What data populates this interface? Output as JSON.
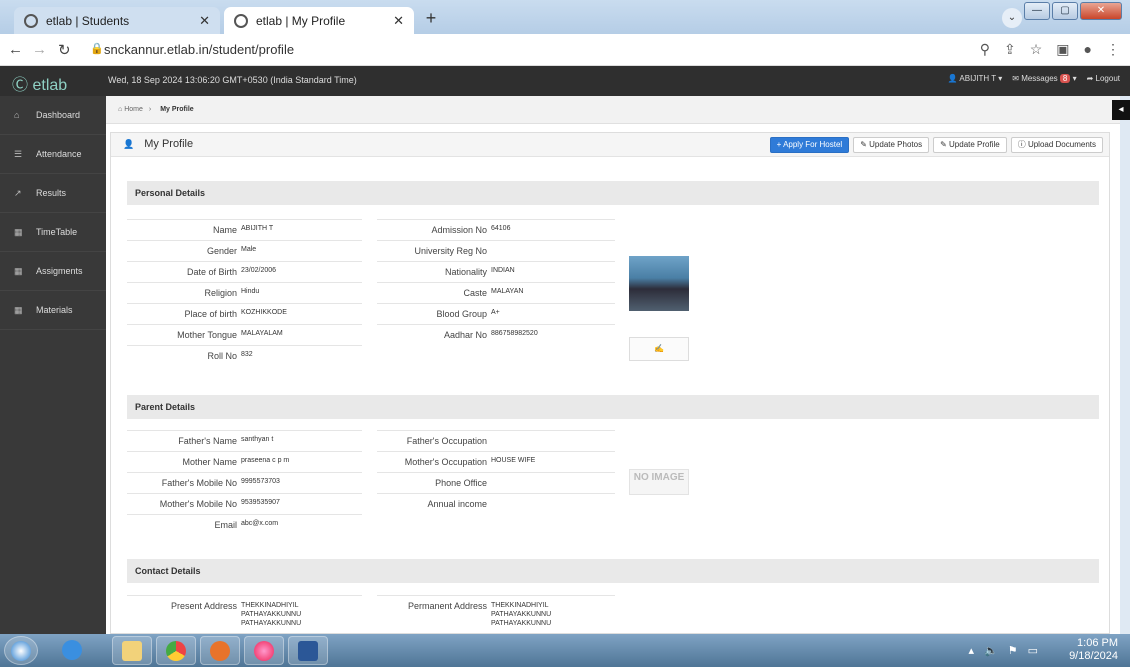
{
  "browser": {
    "tabs": [
      {
        "title": "etlab | Students"
      },
      {
        "title": "etlab | My Profile"
      }
    ],
    "url": "snckannur.etlab.in/student/profile"
  },
  "app": {
    "logo": "etlab",
    "datetime": "Wed, 18 Sep 2024   13:06:20 GMT+0530 (India Standard Time)",
    "user": "ABIJITH T",
    "messages_label": "Messages",
    "messages_count": "8",
    "logout": "Logout"
  },
  "sidebar": {
    "items": [
      {
        "label": "Dashboard",
        "icon": "home-icon"
      },
      {
        "label": "Attendance",
        "icon": "list-icon"
      },
      {
        "label": "Results",
        "icon": "chart-icon"
      },
      {
        "label": "TimeTable",
        "icon": "grid-icon"
      },
      {
        "label": "Assigments",
        "icon": "grid-icon"
      },
      {
        "label": "Materials",
        "icon": "grid-icon"
      }
    ]
  },
  "breadcrumb": {
    "home": "Home",
    "current": "My Profile"
  },
  "page": {
    "title": "My Profile",
    "buttons": {
      "hostel": "Apply For Hostel",
      "photos": "Update Photos",
      "profile": "Update Profile",
      "documents": "Upload Documents"
    }
  },
  "personal": {
    "heading": "Personal Details",
    "left": [
      {
        "label": "Name",
        "value": "ABIJITH T"
      },
      {
        "label": "Gender",
        "value": "Male"
      },
      {
        "label": "Date of Birth",
        "value": "23/02/2006"
      },
      {
        "label": "Religion",
        "value": "Hindu"
      },
      {
        "label": "Place of birth",
        "value": "KOZHIKKODE"
      },
      {
        "label": "Mother Tongue",
        "value": "MALAYALAM"
      },
      {
        "label": "Roll No",
        "value": "832"
      }
    ],
    "right": [
      {
        "label": "Admission No",
        "value": "64106"
      },
      {
        "label": "University Reg No",
        "value": ""
      },
      {
        "label": "Nationality",
        "value": "INDIAN"
      },
      {
        "label": "Caste",
        "value": "MALAYAN"
      },
      {
        "label": "Blood Group",
        "value": "A+"
      },
      {
        "label": "Aadhar No",
        "value": "886758982520"
      }
    ]
  },
  "parent": {
    "heading": "Parent Details",
    "left": [
      {
        "label": "Father's Name",
        "value": "santhyan t"
      },
      {
        "label": "Mother Name",
        "value": "praseena c p m"
      },
      {
        "label": "Father's Mobile No",
        "value": "9995573703"
      },
      {
        "label": "Mother's Mobile No",
        "value": "9539535907"
      },
      {
        "label": "Email",
        "value": "abc@x.com"
      }
    ],
    "right": [
      {
        "label": "Father's Occupation",
        "value": ""
      },
      {
        "label": "Mother's Occupation",
        "value": "HOUSE WIFE"
      },
      {
        "label": "Phone Office",
        "value": ""
      },
      {
        "label": "Annual income",
        "value": ""
      }
    ],
    "no_image": "NO IMAGE"
  },
  "contact": {
    "heading": "Contact Details",
    "present_label": "Present Address",
    "present_value": "THEKKINADHIYIL\nPATHAYAKKUNNU\nPATHAYAKKUNNU",
    "permanent_label": "Permanent Address",
    "permanent_value": "THEKKINADHIYIL\nPATHAYAKKUNNU\nPATHAYAKKUNNU"
  },
  "taskbar": {
    "time": "1:06 PM",
    "date": "9/18/2024"
  }
}
